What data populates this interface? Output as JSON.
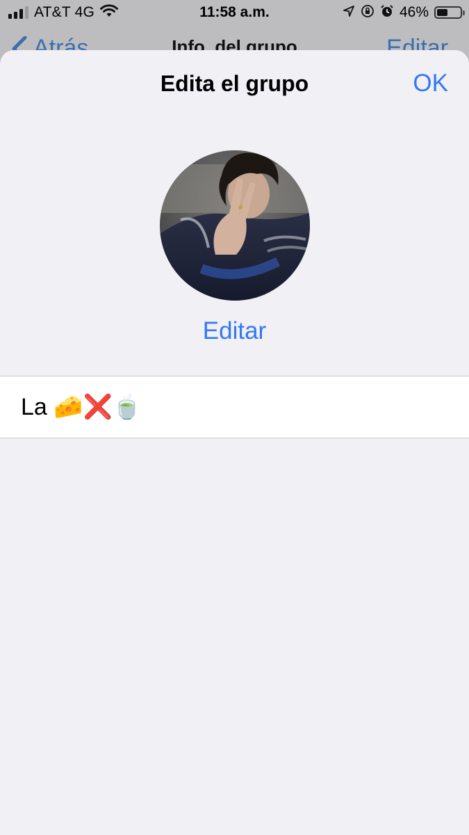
{
  "status_bar": {
    "carrier": "AT&T 4G",
    "time": "11:58 a.m.",
    "battery_percent": "46%",
    "battery_level": 0.46,
    "icons": [
      "signal-icon",
      "wifi-icon",
      "location-icon",
      "orientation-lock-icon",
      "alarm-icon",
      "battery-icon"
    ]
  },
  "background_nav": {
    "back_label": "Atrás",
    "title": "Info. del grupo",
    "edit_label": "Editar"
  },
  "sheet": {
    "title": "Edita el grupo",
    "ok_label": "OK",
    "edit_photo_label": "Editar",
    "group_name": "La 🧀❌🍵"
  },
  "colors": {
    "accent": "#3478f6",
    "sheet_background": "#f0f0f5",
    "row_background": "#ffffff"
  }
}
